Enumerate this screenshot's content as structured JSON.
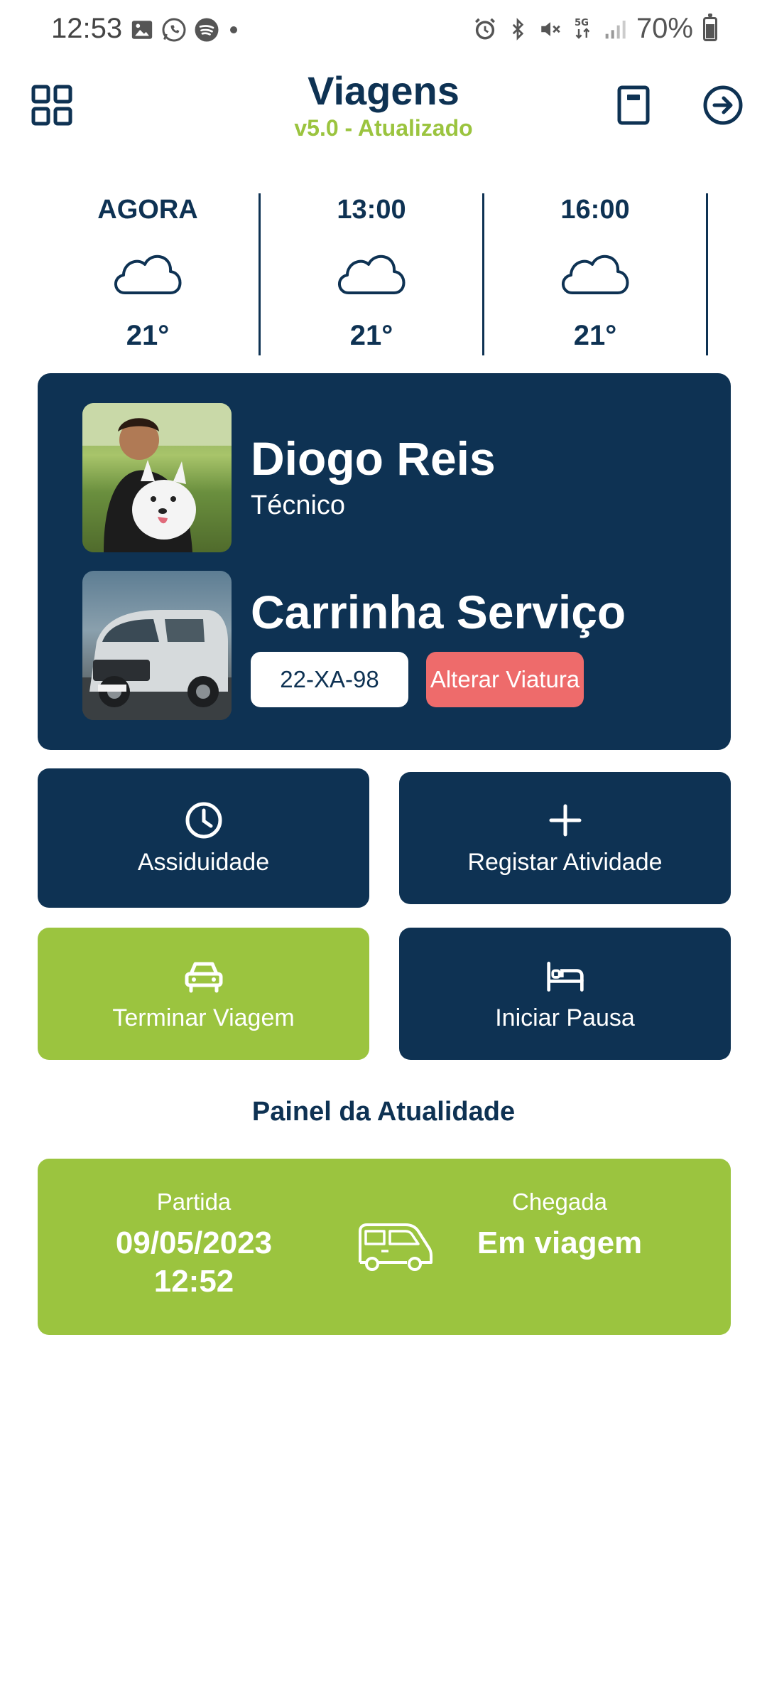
{
  "status_bar": {
    "time": "12:53",
    "notification_icons": [
      "gallery-icon",
      "whatsapp-icon",
      "spotify-icon",
      "dot-icon"
    ],
    "system_icons": [
      "alarm-icon",
      "bluetooth-icon",
      "mute-icon",
      "5g-icon",
      "signal-icon"
    ],
    "battery_percent": "70%",
    "battery_level": 0.7
  },
  "header": {
    "title": "Viagens",
    "subtitle": "v5.0 - Atualizado",
    "left_icon": "grid-icon",
    "right_icons": [
      "book-icon",
      "exit-arrow-icon"
    ]
  },
  "weather": [
    {
      "time": "AGORA",
      "icon": "cloud-icon",
      "temp": "21°"
    },
    {
      "time": "13:00",
      "icon": "cloud-icon",
      "temp": "21°"
    },
    {
      "time": "16:00",
      "icon": "cloud-icon",
      "temp": "21°"
    }
  ],
  "profile": {
    "name": "Diogo Reis",
    "role": "Técnico",
    "vehicle_name": "Carrinha Serviço",
    "plate": "22-XA-98",
    "change_vehicle_label": "Alterar Viatura"
  },
  "actions": {
    "attendance": {
      "label": "Assiduidade",
      "icon": "clock-icon"
    },
    "register": {
      "label": "Registar Atividade",
      "icon": "plus-icon"
    },
    "end_trip": {
      "label": "Terminar Viagem",
      "icon": "car-icon"
    },
    "start_break": {
      "label": "Iniciar Pausa",
      "icon": "bed-icon"
    }
  },
  "panel": {
    "title": "Painel da Atualidade",
    "departure_label": "Partida",
    "departure_date": "09/05/2023",
    "departure_time": "12:52",
    "arrival_label": "Chegada",
    "arrival_value": "Em viagem",
    "icon": "van-icon"
  },
  "colors": {
    "navy": "#0e3253",
    "green": "#9bc43f",
    "red": "#ee6b6b",
    "white": "#ffffff"
  }
}
